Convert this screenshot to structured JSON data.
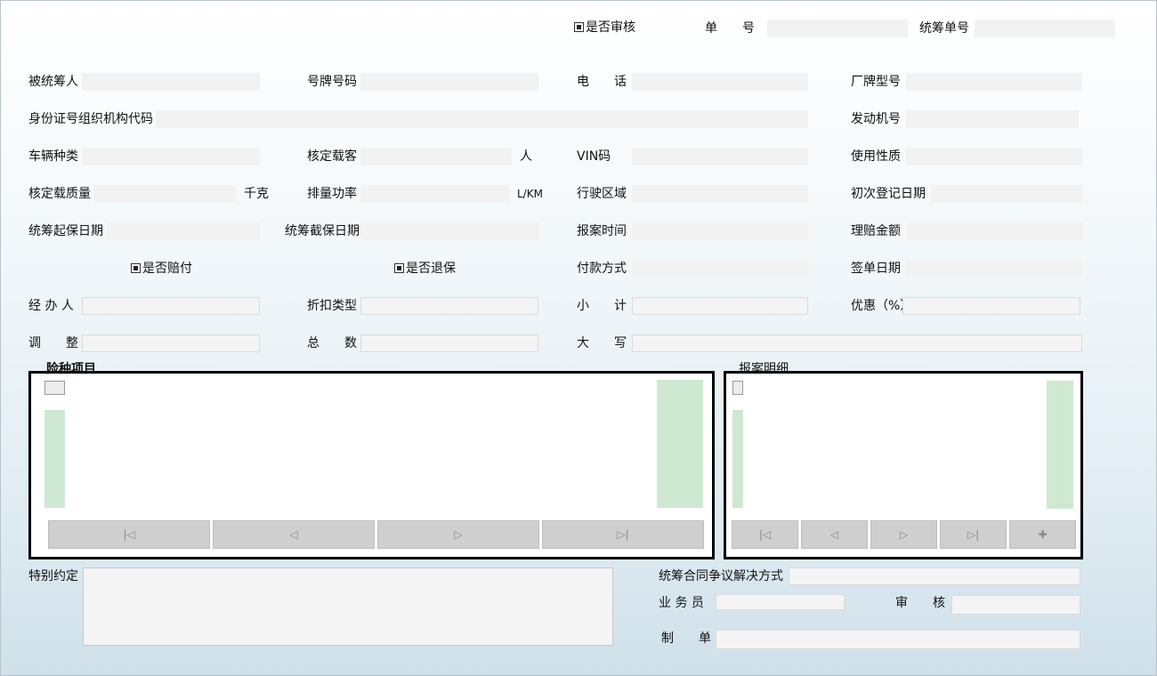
{
  "top": {
    "audit_check": "是否审核",
    "order_no_label": "单　　号",
    "order_no": "",
    "pool_no_label": "统筹单号",
    "pool_no": ""
  },
  "fields": {
    "insured": {
      "label": "被统筹人",
      "value": ""
    },
    "plate": {
      "label": "号牌号码",
      "value": ""
    },
    "phone": {
      "label": "电　　话",
      "value": ""
    },
    "model": {
      "label": "厂牌型号",
      "value": ""
    },
    "idcode": {
      "label": "身份证号组织机构代码",
      "value": ""
    },
    "engine": {
      "label": "发动机号",
      "value": ""
    },
    "vtype": {
      "label": "车辆种类",
      "value": ""
    },
    "seats": {
      "label": "核定载客",
      "value": "",
      "unit": "人"
    },
    "vin": {
      "label": "VIN码",
      "value": ""
    },
    "usage": {
      "label": "使用性质",
      "value": ""
    },
    "load": {
      "label": "核定载质量",
      "value": "",
      "unit": "千克"
    },
    "displacement": {
      "label": "排量功率",
      "value": "",
      "unit": "L/KM"
    },
    "region": {
      "label": "行驶区域",
      "value": ""
    },
    "regdate": {
      "label": "初次登记日期",
      "value": ""
    },
    "start": {
      "label": "统筹起保日期",
      "value": ""
    },
    "end": {
      "label": "统筹截保日期",
      "value": ""
    },
    "reporttime": {
      "label": "报案时间",
      "value": ""
    },
    "claim": {
      "label": "理赔金额",
      "value": ""
    },
    "paymethod": {
      "label": "付款方式",
      "value": ""
    },
    "signdate": {
      "label": "签单日期",
      "value": ""
    },
    "handler": {
      "label": "经 办 人",
      "value": ""
    },
    "discounttype": {
      "label": "折扣类型",
      "value": ""
    },
    "subtotal": {
      "label": "小　　计",
      "value": ""
    },
    "discount": {
      "label": "优惠（%）",
      "value": ""
    },
    "adjust": {
      "label": "调　　整",
      "value": ""
    },
    "total": {
      "label": "总　　数",
      "value": ""
    },
    "uppercase": {
      "label": "大　　写",
      "value": ""
    }
  },
  "checks": {
    "paid": "是否赔付",
    "refund": "是否退保"
  },
  "panels": {
    "coverage_title": "险种项目",
    "report_title": "报案明细"
  },
  "nav": {
    "first": "|◁",
    "prev": "◁",
    "next": "▷",
    "last": "▷|",
    "add": "✚"
  },
  "bottom": {
    "special_label": "特别约定",
    "special_value": "",
    "dispute_label": "统筹合同争议解决方式",
    "dispute_value": "",
    "salesman_label": "业 务 员",
    "salesman_value": "",
    "reviewer_label": "审　　核",
    "reviewer_value": "",
    "maker_label": "制　　单",
    "maker_value": ""
  }
}
